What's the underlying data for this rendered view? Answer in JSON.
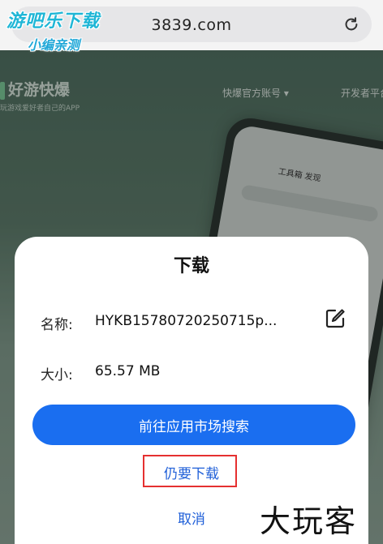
{
  "browser": {
    "url": "3839.com",
    "reload_icon": "reload-icon"
  },
  "watermark": {
    "top_line1": "游吧乐下载",
    "top_line2": "小编亲测",
    "bottom": "大玩客"
  },
  "site": {
    "logo": "好游快爆",
    "tagline": "玩游戏爱好者自己的APP",
    "nav_official": "快爆官方账号 ▾",
    "nav_developer": "开发者平台",
    "phone_tabs": "工具箱    发现"
  },
  "dialog": {
    "title": "下载",
    "name_label": "名称:",
    "name_value": "HYKB15780720250715p...",
    "size_label": "大小:",
    "size_value": "65.57 MB",
    "edit_icon": "edit-icon",
    "primary_button": "前往应用市场搜索",
    "download_anyway": "仍要下载",
    "cancel": "取消",
    "highlight_color": "#e53030",
    "primary_color": "#1a6ef0"
  }
}
